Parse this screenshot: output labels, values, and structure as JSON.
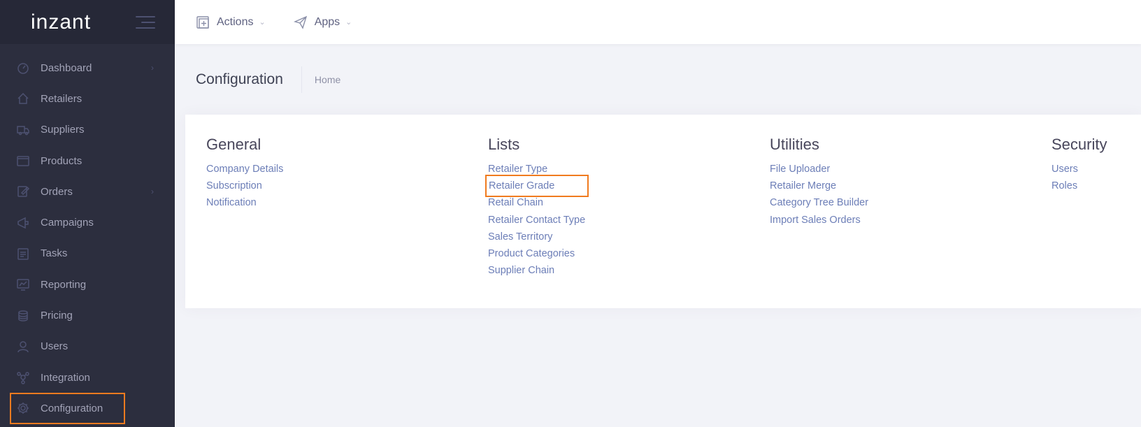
{
  "brand": {
    "logo": "inzant"
  },
  "sidebar": {
    "items": [
      {
        "label": "Dashboard",
        "icon": "dashboard-icon",
        "chevron": true
      },
      {
        "label": "Retailers",
        "icon": "home-icon",
        "chevron": false
      },
      {
        "label": "Suppliers",
        "icon": "truck-icon",
        "chevron": false
      },
      {
        "label": "Products",
        "icon": "box-icon",
        "chevron": false
      },
      {
        "label": "Orders",
        "icon": "edit-icon",
        "chevron": true
      },
      {
        "label": "Campaigns",
        "icon": "megaphone-icon",
        "chevron": false
      },
      {
        "label": "Tasks",
        "icon": "clipboard-icon",
        "chevron": false
      },
      {
        "label": "Reporting",
        "icon": "chart-icon",
        "chevron": false
      },
      {
        "label": "Pricing",
        "icon": "coins-icon",
        "chevron": false
      },
      {
        "label": "Users",
        "icon": "user-icon",
        "chevron": false
      },
      {
        "label": "Integration",
        "icon": "network-icon",
        "chevron": false
      },
      {
        "label": "Configuration",
        "icon": "gear-icon",
        "chevron": false,
        "active": true
      }
    ]
  },
  "topbar": {
    "actions_label": "Actions",
    "apps_label": "Apps"
  },
  "subheader": {
    "title": "Configuration",
    "breadcrumb": "Home"
  },
  "sections": [
    {
      "title": "General",
      "links": [
        "Company Details",
        "Subscription",
        "Notification"
      ]
    },
    {
      "title": "Lists",
      "links": [
        "Retailer Type",
        "Retailer Grade",
        "Retail Chain",
        "Retailer Contact Type",
        "Sales Territory",
        "Product Categories",
        "Supplier Chain"
      ]
    },
    {
      "title": "Utilities",
      "links": [
        "File Uploader",
        "Retailer Merge",
        "Category Tree Builder",
        "Import Sales Orders"
      ]
    },
    {
      "title": "Security",
      "links": [
        "Users",
        "Roles"
      ]
    }
  ],
  "colors": {
    "sidebar_bg": "#2c2e3e",
    "brand_bg": "#262837",
    "link": "#6c7eb7",
    "highlight": "#f07b1f"
  }
}
